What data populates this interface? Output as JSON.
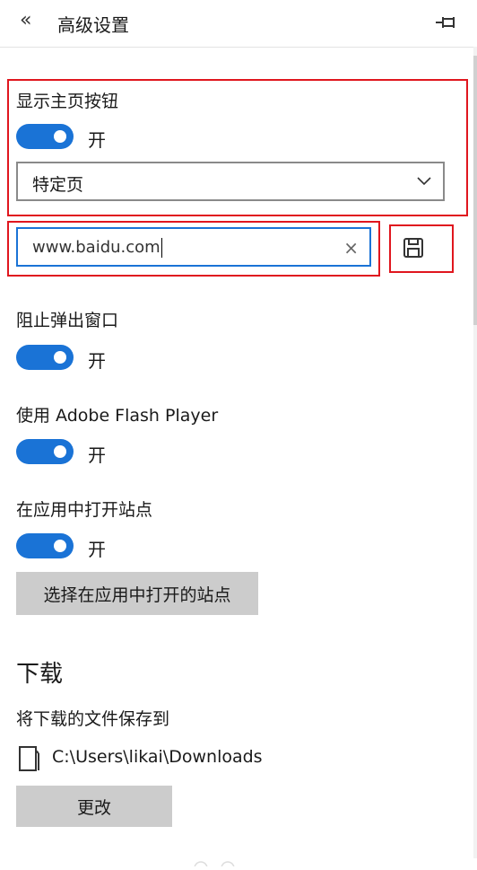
{
  "header": {
    "back_glyph": "«",
    "title": "高级设置"
  },
  "home_button": {
    "label": "显示主页按钮",
    "toggle_state": "开",
    "select_value": "特定页",
    "url_value": "www.baidu.com",
    "clear_glyph": "×"
  },
  "block_popups": {
    "label": "阻止弹出窗口",
    "toggle_state": "开"
  },
  "flash": {
    "label": "使用 Adobe Flash Player",
    "toggle_state": "开"
  },
  "open_in_app": {
    "label": "在应用中打开站点",
    "toggle_state": "开",
    "button_label": "选择在应用中打开的站点"
  },
  "downloads": {
    "heading": "下载",
    "save_to_label": "将下载的文件保存到",
    "path": "C:\\Users\\likai\\Downloads",
    "change_button": "更改"
  },
  "colors": {
    "accent": "#1a73d6",
    "highlight": "#e0161e",
    "button_gray": "#cccccc"
  },
  "icons": [
    "chevron-double-left-icon",
    "pin-icon",
    "chevron-down-icon",
    "clear-icon",
    "save-icon",
    "folder-icon"
  ]
}
